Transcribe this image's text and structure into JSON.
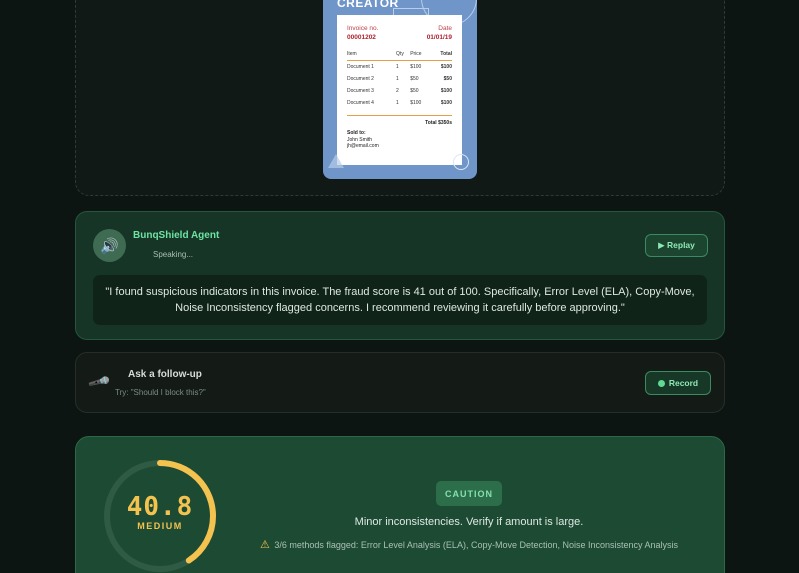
{
  "invoice_preview": {
    "brand": "CREATOR",
    "invoice_no_label": "Invoice no.",
    "invoice_no": "00001202",
    "date_label": "Date",
    "date": "01/01/19",
    "columns": [
      "Item",
      "Qty",
      "Price",
      "Total"
    ],
    "rows": [
      [
        "Document 1",
        "1",
        "$100",
        "$100"
      ],
      [
        "Document 2",
        "1",
        "$50",
        "$50"
      ],
      [
        "Document 3",
        "2",
        "$50",
        "$100"
      ],
      [
        "Document 4",
        "1",
        "$100",
        "$100"
      ]
    ],
    "grand_total": "Total $350s",
    "sold_to_label": "Sold to:",
    "sold_to_name": "John Smith",
    "sold_to_email": "jh@email.com"
  },
  "agent": {
    "name": "BunqShield Agent",
    "status": "Speaking...",
    "replay_label": "▶ Replay",
    "message": "\"I found suspicious indicators in this invoice. The fraud score is 41 out of 100. Specifically, Error Level (ELA), Copy-Move, Noise Inconsistency flagged concerns. I recommend reviewing it carefully before approving.\""
  },
  "followup": {
    "title": "Ask a follow-up",
    "hint": "Try: \"Should I block this?\"",
    "record_label": "Record"
  },
  "score": {
    "value": "40.8",
    "fraction": 0.408,
    "level": "MEDIUM",
    "badge": "CAUTION",
    "verdict": "Minor inconsistencies. Verify if amount is large.",
    "methods": "3/6 methods flagged: Error Level Analysis (ELA), Copy-Move Detection, Noise Inconsistency Analysis"
  },
  "colors": {
    "accent": "#6ee3a1",
    "gauge": "#f3c24f",
    "gauge_track": "#2f5a43"
  },
  "icons": {
    "avatar": "speaker-icon",
    "mic": "microphone-icon",
    "warning": "warning-icon"
  }
}
